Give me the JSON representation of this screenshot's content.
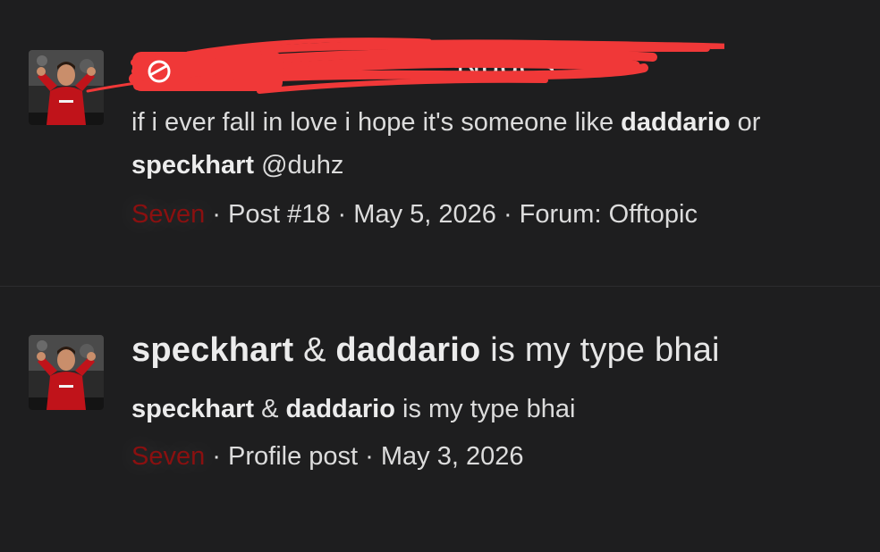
{
  "results": [
    {
      "title_visible_suffix": "Nudes",
      "snippet": {
        "line1_prefix": "if i ever fall in love i hope it's someone like ",
        "bold1": "daddario",
        "mid": " or",
        "bold2": "speckhart",
        "suffix": " @duhz"
      },
      "meta": {
        "username": "Seven",
        "sep1": " · ",
        "type": "Post #18",
        "sep2": " · ",
        "date": "May 5, 2026",
        "sep3": " · ",
        "forum": "Forum: Offtopic"
      }
    },
    {
      "title": {
        "bold1": "speckhart",
        "amp": " & ",
        "bold2": "daddario",
        "rest": " is my type bhai"
      },
      "snippet": {
        "bold1": "speckhart",
        "amp": " & ",
        "bold2": "daddario",
        "rest": " is my type bhai"
      },
      "meta": {
        "username": "Seven",
        "sep1": " · ",
        "type": "Profile post",
        "sep2": " · ",
        "date": "May 3, 2026"
      }
    }
  ],
  "colors": {
    "background": "#1e1e1f",
    "username": "#8a1010",
    "redaction": "#f03838"
  },
  "icons": {
    "avatar": "user-avatar-footballer-red-kit"
  }
}
